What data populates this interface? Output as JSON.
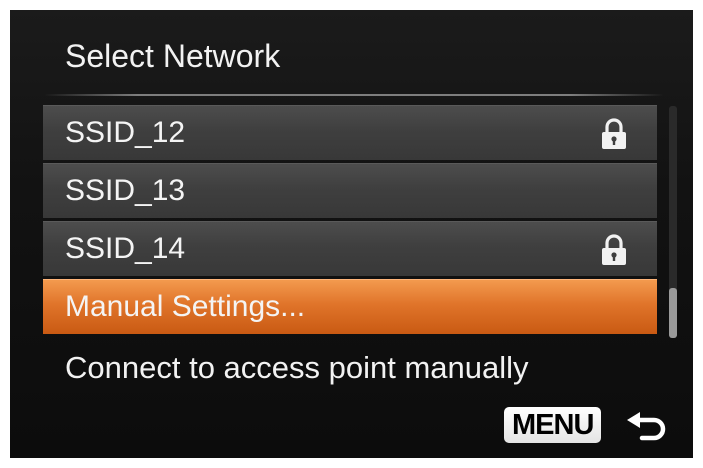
{
  "screen": {
    "title": "Select Network",
    "networks": [
      {
        "label": "SSID_12",
        "locked": true,
        "selected": false
      },
      {
        "label": "SSID_13",
        "locked": false,
        "selected": false
      },
      {
        "label": "SSID_14",
        "locked": true,
        "selected": false
      },
      {
        "label": "Manual Settings...",
        "locked": false,
        "selected": true
      }
    ],
    "description": "Connect to access point manually",
    "footer": {
      "menu_label": "MENU",
      "back_icon": "return-arrow-icon"
    },
    "colors": {
      "selected_highlight": "#e0742a",
      "row_background": "#3f3f3f",
      "text": "#f2f2f2"
    }
  }
}
